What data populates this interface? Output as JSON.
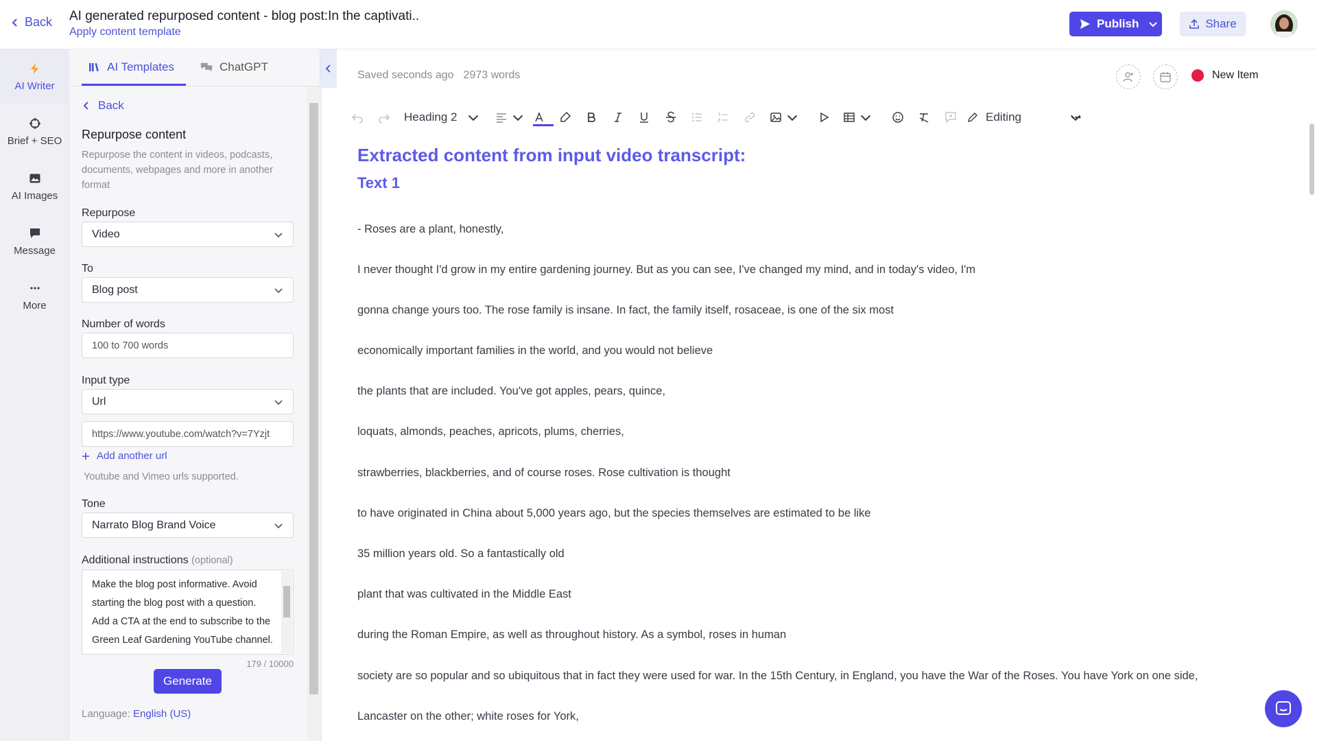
{
  "header": {
    "back_label": "Back",
    "title": "AI generated repurposed content - blog post:In the captivati..",
    "template_link": "Apply content template",
    "publish_label": "Publish",
    "share_label": "Share"
  },
  "rail": {
    "items": [
      {
        "label": "AI Writer",
        "icon": "bolt-icon"
      },
      {
        "label": "Brief + SEO",
        "icon": "target-icon"
      },
      {
        "label": "AI Images",
        "icon": "image-icon"
      },
      {
        "label": "Message",
        "icon": "chat-bubble-icon"
      },
      {
        "label": "More",
        "icon": "ellipsis-icon"
      }
    ]
  },
  "panel": {
    "tabs": [
      {
        "label": "AI Templates",
        "icon": "library-icon"
      },
      {
        "label": "ChatGPT",
        "icon": "chat-icon"
      }
    ],
    "back_label": "Back",
    "heading": "Repurpose content",
    "description": "Repurpose the content in videos, podcasts, documents, webpages and more in another format",
    "repurpose": {
      "label": "Repurpose",
      "value": "Video"
    },
    "to": {
      "label": "To",
      "value": "Blog post"
    },
    "words": {
      "label": "Number of words",
      "value": "100 to 700 words"
    },
    "input_type": {
      "label": "Input type",
      "value": "Url"
    },
    "url_value": "https://www.youtube.com/watch?v=7Yzjt",
    "add_url_label": "Add another url",
    "hint": "Youtube and Vimeo urls supported.",
    "tone": {
      "label": "Tone",
      "value": "Narrato Blog Brand Voice"
    },
    "instructions": {
      "label": "Additional instructions",
      "optional": "(optional)",
      "value": "Make the blog post informative. Avoid starting the blog post with a question. Add a CTA at the end to subscribe to the Green Leaf Gardening YouTube channel.",
      "counter": "179 / 10000"
    },
    "generate_label": "Generate",
    "language_prefix": "Language:",
    "language_value": "English (US)"
  },
  "editor": {
    "saved": "Saved seconds ago",
    "words": "2973 words",
    "status_label": "New Item",
    "status_color": "#e11d48",
    "heading_select": "Heading 2",
    "mode_label": "Editing",
    "accent": "#4f46e5",
    "h1": "Extracted content from input video transcript:",
    "h2": "Text 1",
    "lines": [
      "- Roses are a plant, honestly,",
      "I never thought I'd grow in my entire gardening journey. But as you can see, I've changed my mind, and in today's video, I'm",
      "gonna change yours too. The rose family is insane. In fact, the family itself, rosaceae, is one of the six most",
      "economically important families in the world, and you would not believe",
      "the plants that are included. You've got apples, pears, quince,",
      "loquats, almonds, peaches, apricots, plums, cherries,",
      "strawberries, blackberries, and of course roses. Rose cultivation is thought",
      "to have originated in China about 5,000 years ago, but the species themselves are estimated to be like",
      "35 million years old. So a fantastically old",
      "plant that was cultivated in the Middle East",
      "during the Roman Empire, as well as throughout history. As a symbol, roses in human",
      "society are so popular and so ubiquitous that in fact they were used for war. In the 15th Century, in England, you have the War of the Roses. You have York on one side,",
      "Lancaster on the other; white roses for York,"
    ]
  }
}
